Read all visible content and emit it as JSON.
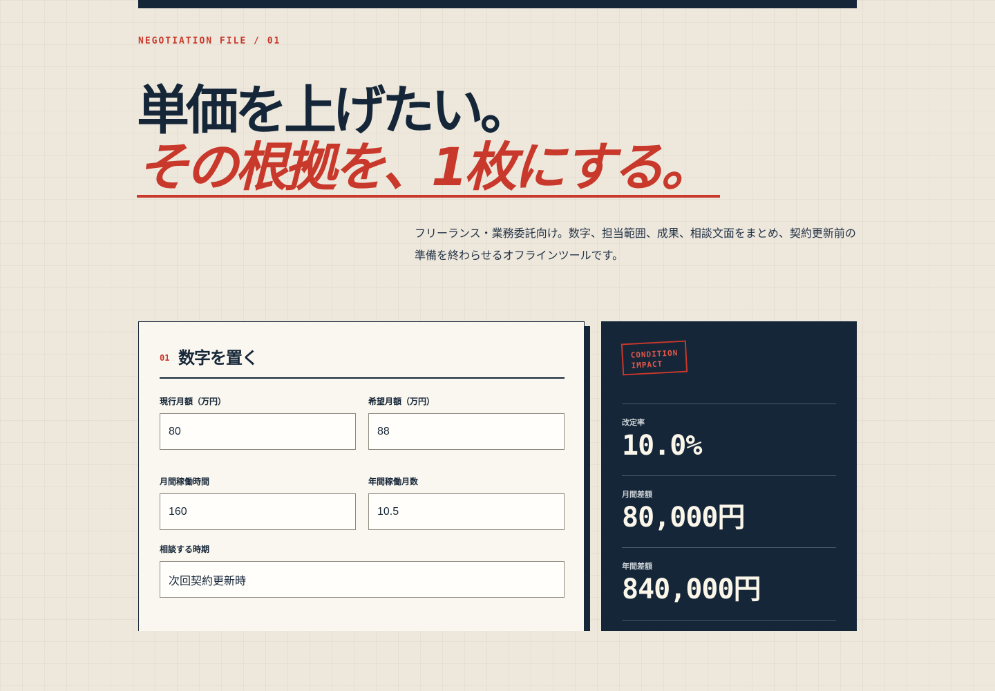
{
  "header": {
    "kicker": "NEGOTIATION FILE / 01",
    "headline_line1": "単価を上げたい。",
    "headline_line2": "その根拠を、1枚にする。",
    "lead": "フリーランス・業務委託向け。数字、担当範囲、成果、相談文面をまとめ、契約更新前の準備を終わらせるオフラインツールです。"
  },
  "form": {
    "step_number": "01",
    "title": "数字を置く",
    "fields": {
      "current_monthly": {
        "label": "現行月額（万円）",
        "value": "80"
      },
      "desired_monthly": {
        "label": "希望月額（万円）",
        "value": "88"
      },
      "monthly_hours": {
        "label": "月間稼働時間",
        "value": "160"
      },
      "annual_months": {
        "label": "年間稼働月数",
        "value": "10.5"
      },
      "timing": {
        "label": "相談する時期",
        "value": "次回契約更新時"
      }
    }
  },
  "impact": {
    "stamp_line1": "CONDITION",
    "stamp_line2": "IMPACT",
    "metrics": [
      {
        "label": "改定率",
        "value": "10.0%"
      },
      {
        "label": "月間差額",
        "value": "80,000円"
      },
      {
        "label": "年間差額",
        "value": "840,000円"
      }
    ]
  },
  "colors": {
    "navy": "#152638",
    "accent_red": "#c8382b",
    "paper": "#eee7dc",
    "card": "#faf7f0"
  }
}
